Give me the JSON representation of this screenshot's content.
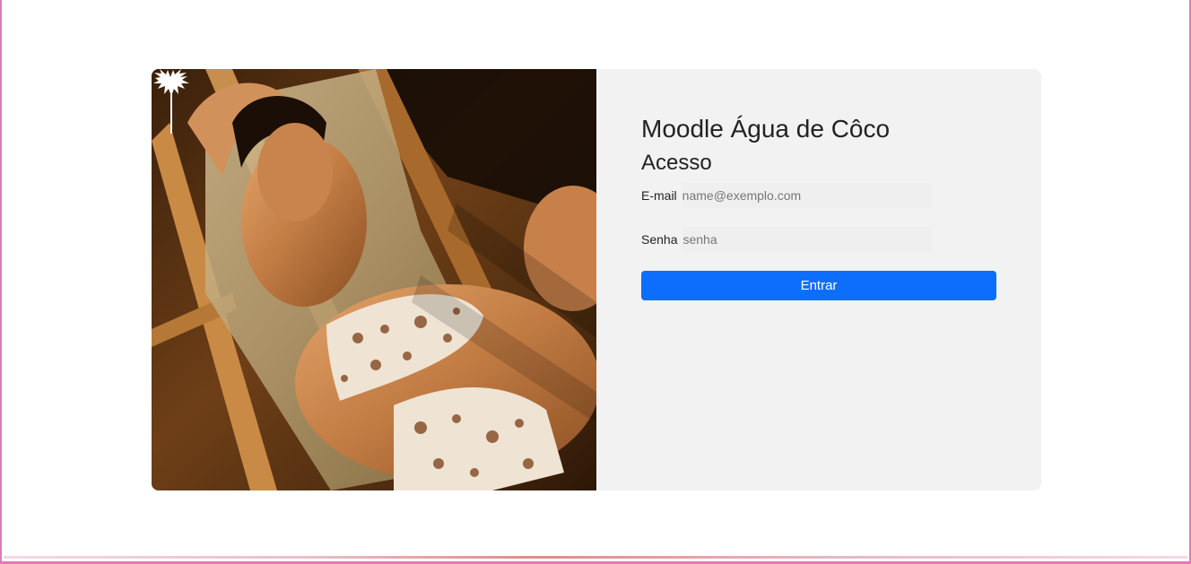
{
  "brand": {
    "logo_icon": "palm-tree-icon",
    "colors": {
      "accent": "#0d6efd",
      "panel": "#f2f2f2",
      "frame_border": "#e27ab7"
    }
  },
  "login": {
    "title": "Moodle Água de Côco",
    "subtitle": "Acesso",
    "email": {
      "label": "E-mail",
      "placeholder": "name@exemplo.com",
      "value": ""
    },
    "password": {
      "label": "Senha",
      "placeholder": "senha",
      "value": ""
    },
    "submit_label": "Entrar"
  }
}
